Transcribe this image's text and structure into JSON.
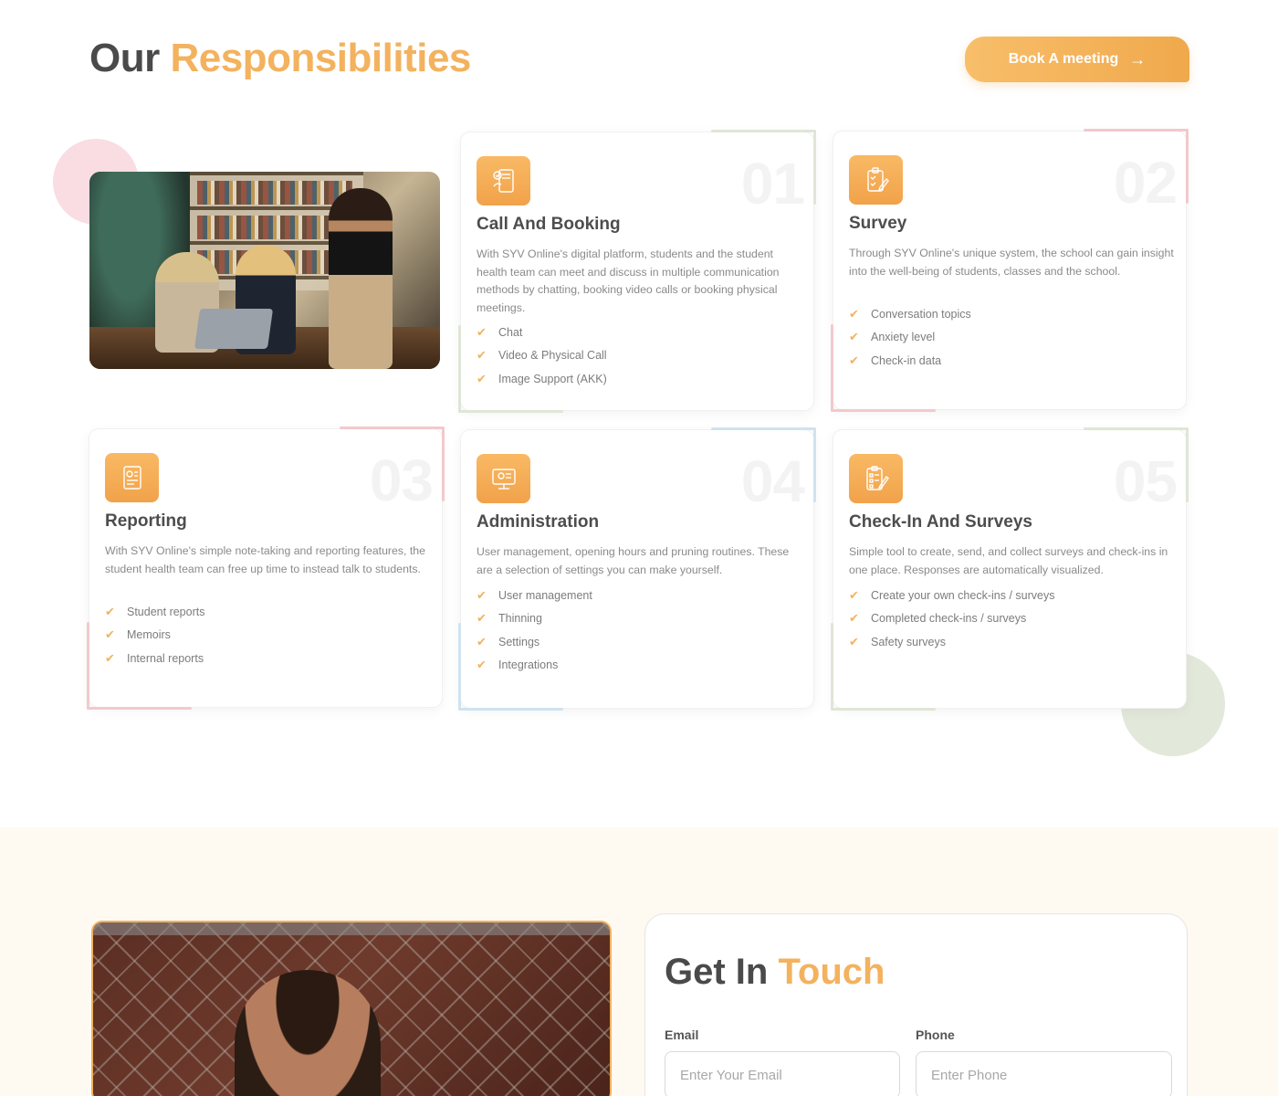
{
  "header": {
    "title_plain": "Our",
    "title_accent": "Responsibilities",
    "book_button": "Book A meeting",
    "book_arrow": "→"
  },
  "cards": [
    {
      "number": "01",
      "title": "Call And Booking",
      "description": "With SYV Online's digital platform, students and the student health team can meet and discuss in multiple communication methods by chatting, booking video calls or booking physical meetings.",
      "features": [
        "Chat",
        "Video & Physical Call",
        "Image Support (AKK)"
      ],
      "icon": "call-booking-icon",
      "accent": "#dfe6d6"
    },
    {
      "number": "02",
      "title": "Survey",
      "description": "Through SYV Online's unique system, the school can gain insight into the well-being of students, classes and the school.",
      "features": [
        "Conversation topics",
        "Anxiety level",
        "Check-in data"
      ],
      "icon": "survey-icon",
      "accent": "#f3c9cc"
    },
    {
      "number": "03",
      "title": "Reporting",
      "description": "With SYV Online's simple note-taking and reporting features, the student health team can free up time to instead talk to students.",
      "features": [
        "Student reports",
        "Memoirs",
        "Internal reports"
      ],
      "icon": "report-icon",
      "accent": "#f3c9cc"
    },
    {
      "number": "04",
      "title": "Administration",
      "description": "User management, opening hours and pruning routines. These are a selection of settings you can make yourself.",
      "features": [
        "User management",
        "Thinning",
        "Settings",
        "Integrations"
      ],
      "icon": "admin-monitor-icon",
      "accent": "#cfe3ef"
    },
    {
      "number": "05",
      "title": "Check-In And Surveys",
      "description": "Simple tool to create, send, and collect surveys and check-ins in one place. Responses are automatically visualized.",
      "features": [
        "Create your own check-ins / surveys",
        "Completed check-ins / surveys",
        "Safety surveys"
      ],
      "icon": "checklist-icon",
      "accent": "#dfe6d6"
    }
  ],
  "check_glyph": "✔",
  "contact": {
    "title_plain": "Get In",
    "title_accent": "Touch",
    "email_label": "Email",
    "email_placeholder": "Enter Your Email",
    "phone_label": "Phone",
    "phone_placeholder": "Enter Phone"
  },
  "colors": {
    "accent": "#f3b25e",
    "heading": "#4a4a4a",
    "contact_bg": "#fffaf1"
  }
}
